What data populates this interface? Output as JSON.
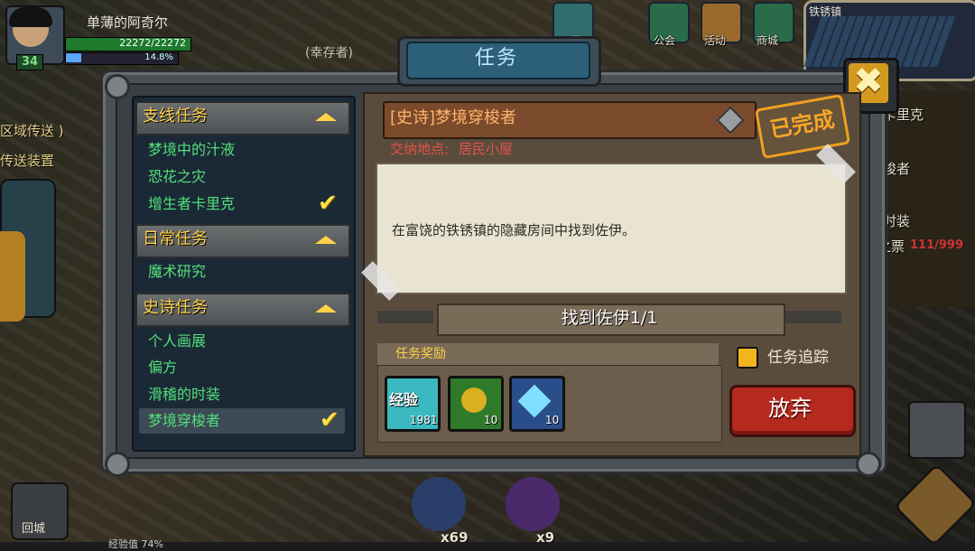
{
  "player": {
    "name": "单薄的阿奇尔",
    "level": "34",
    "hp": "22272/22272",
    "exp_percent": "14.8%"
  },
  "top_menu": [
    {
      "label": "常",
      "icon": "daily-icon"
    },
    {
      "label": "公会",
      "icon": "guild-icon"
    },
    {
      "label": "活动",
      "icon": "event-icon"
    },
    {
      "label": "商城",
      "icon": "shop-icon"
    }
  ],
  "map": {
    "name": "铁锈镇"
  },
  "background_hints": {
    "left_1": "区域传送 )",
    "left_2": "传送装置",
    "behind_title": "(幸存者)",
    "right_1": "卡里克",
    "right_2": "梭者",
    "right_3": "时装",
    "right_4": "之票",
    "right_count": "111/999",
    "bottom_left": "回城",
    "count_1": "x69",
    "count_2": "x9",
    "exp_bar": "经验值 74%"
  },
  "dialog": {
    "title": "任务",
    "close_symbol": "✖"
  },
  "quest_list": {
    "categories": [
      {
        "label": "支线任务",
        "items": [
          {
            "label": "梦境中的汁液",
            "completed": false
          },
          {
            "label": "恐花之灾",
            "completed": false
          },
          {
            "label": "增生者卡里克",
            "completed": true
          }
        ]
      },
      {
        "label": "日常任务",
        "items": [
          {
            "label": "魔术研究",
            "completed": false
          }
        ]
      },
      {
        "label": "史诗任务",
        "items": [
          {
            "label": "个人画展",
            "completed": false
          },
          {
            "label": "偏方",
            "completed": false
          },
          {
            "label": "滑稽的时装",
            "completed": false
          },
          {
            "label": "梦境穿梭者",
            "completed": true,
            "selected": true
          }
        ]
      }
    ],
    "check_symbol": "✔"
  },
  "detail": {
    "title": "[史诗]梦境穿梭者",
    "status_stamp": "已完成",
    "location_label": "交纳地点:",
    "location_value": "居民小屋",
    "description": "在富饶的铁锈镇的隐藏房间中找到佐伊。",
    "objective": "找到佐伊1/1",
    "reward_label": "任务奖励",
    "rewards": [
      {
        "name": "经验",
        "count": "1981",
        "icon": "exp-icon"
      },
      {
        "name": "",
        "count": "10",
        "icon": "gold-pot-icon"
      },
      {
        "name": "",
        "count": "10",
        "icon": "crystal-icon"
      }
    ],
    "track_label": "任务追踪",
    "track_checked": true,
    "abandon_label": "放弃"
  },
  "colors": {
    "accent_gold": "#ffd24a",
    "quest_green": "#52e07a",
    "abandon_red": "#b52a1e",
    "title_blue": "#2c5f78"
  }
}
